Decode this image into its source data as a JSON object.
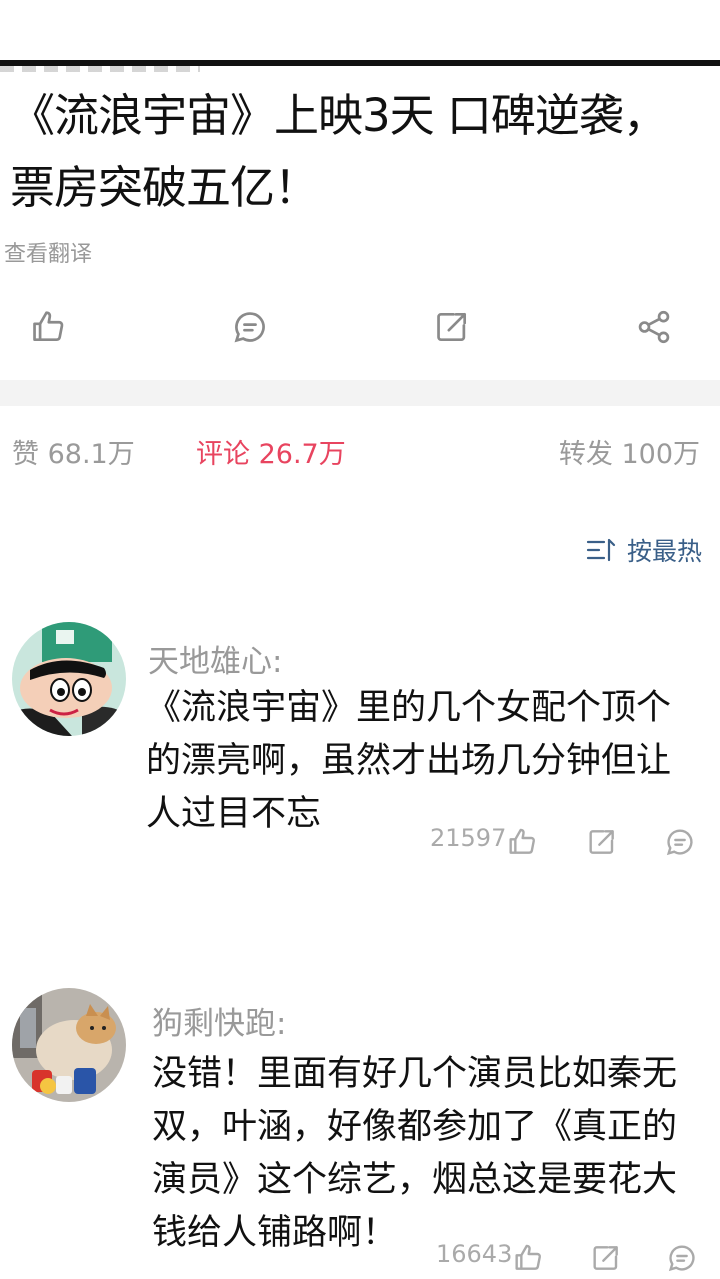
{
  "post": {
    "title": "《流浪宇宙》上映3天 口碑逆袭，票房突破五亿！",
    "translate_label": "查看翻译"
  },
  "actions": [
    {
      "icon": "thumbs-up-icon"
    },
    {
      "icon": "comment-icon"
    },
    {
      "icon": "repost-icon"
    },
    {
      "icon": "share-icon"
    }
  ],
  "stats": {
    "likes": "赞 68.1万",
    "comments": "评论 26.7万",
    "reposts": "转发 100万"
  },
  "sort": {
    "icon": "sort-icon",
    "label": "按最热"
  },
  "comments": [
    {
      "user": "天地雄心:",
      "text": "《流浪宇宙》里的几个女配个顶个的漂亮啊，虽然才出场几分钟但让人过目不忘",
      "likes": "21597"
    },
    {
      "user": "狗剩快跑:",
      "text": "没错！里面有好几个演员比如秦无双，叶涵，好像都参加了《真正的演员》这个综艺，烟总这是要花大钱给人铺路啊！",
      "likes": "16643"
    }
  ],
  "colors": {
    "accent": "#e8445f",
    "sort_blue": "#3a5f88",
    "muted": "#9a9a9a"
  }
}
